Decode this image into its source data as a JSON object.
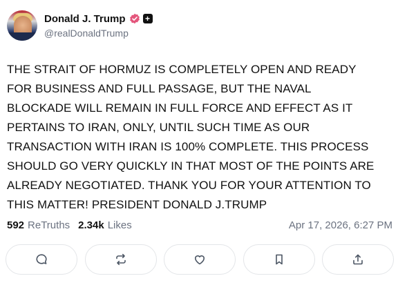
{
  "author": {
    "display_name": "Donald J. Trump",
    "handle": "@realDonaldTrump",
    "avatar_icon": "profile-photo",
    "verified_icon": "verified-badge-icon",
    "verified_color": "#e4567c",
    "extra_badge_icon": "plus-badge-icon"
  },
  "post": {
    "lines": [
      "THE STRAIT OF HORMUZ IS COMPLETELY OPEN AND READY",
      "FOR BUSINESS AND FULL PASSAGE, BUT THE NAVAL",
      "BLOCKADE WILL REMAIN IN FULL FORCE AND EFFECT AS IT",
      "PERTAINS TO IRAN, ONLY, UNTIL SUCH TIME AS OUR",
      "TRANSACTION WITH IRAN IS 100% COMPLETE. THIS PROCESS",
      "SHOULD GO VERY QUICKLY IN THAT MOST OF THE POINTS ARE",
      "ALREADY NEGOTIATED. THANK YOU FOR YOUR ATTENTION TO",
      "THIS MATTER! PRESIDENT DONALD J.TRUMP"
    ]
  },
  "stats": {
    "retruths_count": "592",
    "retruths_label": "ReTruths",
    "likes_count": "2.34k",
    "likes_label": "Likes",
    "timestamp": "Apr 17, 2026, 6:27 PM"
  },
  "actions": [
    {
      "name": "reply-button",
      "icon": "comment-icon"
    },
    {
      "name": "retruth-button",
      "icon": "repost-icon"
    },
    {
      "name": "like-button",
      "icon": "heart-icon"
    },
    {
      "name": "bookmark-button",
      "icon": "bookmark-icon"
    },
    {
      "name": "share-button",
      "icon": "share-icon"
    }
  ]
}
